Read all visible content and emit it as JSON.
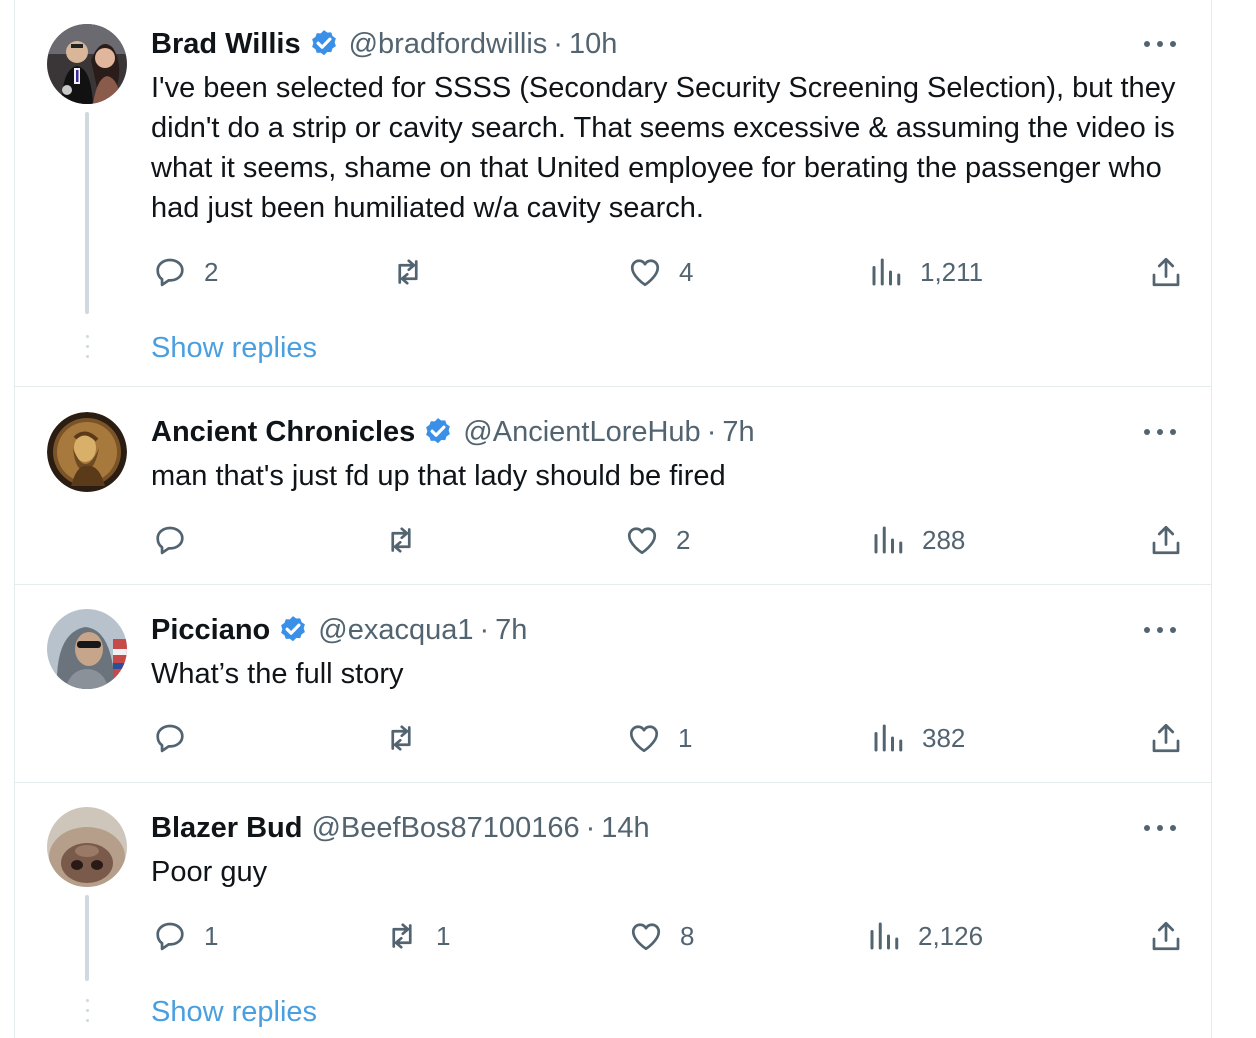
{
  "colors": {
    "link": "#4a9fe0",
    "verified": "#3a8fe8",
    "muted": "#536471",
    "border": "#e6ebee",
    "thread": "#cfd9de"
  },
  "tweets": [
    {
      "name": "Brad Willis",
      "verified": true,
      "handle": "@bradfordwillis",
      "sep": "·",
      "time": "10h",
      "text": "I've been selected for SSSS (Secondary Security Screening Selection), but they didn't do a strip or cavity search.  That seems excessive & assuming the video is what it seems, shame on that United employee for berating the passenger who had just been humiliated w/a cavity search.",
      "replies": "2",
      "retweets": "",
      "likes": "4",
      "views": "1,211",
      "show_replies": "Show replies",
      "icons": [
        "reply-icon",
        "retweet-icon",
        "like-icon",
        "views-icon",
        "share-icon",
        "more-icon"
      ]
    },
    {
      "name": "Ancient Chronicles",
      "verified": true,
      "handle": "@AncientLoreHub",
      "sep": "·",
      "time": "7h",
      "text": "man that's  just fd up that lady should be fired",
      "replies": "",
      "retweets": "",
      "likes": "2",
      "views": "288"
    },
    {
      "name": "Picciano",
      "verified": true,
      "handle": "@exacqua1",
      "sep": "·",
      "time": "7h",
      "text": "What’s the full story",
      "replies": "",
      "retweets": "",
      "likes": "1",
      "views": "382"
    },
    {
      "name": "Blazer Bud",
      "verified": false,
      "handle": "@BeefBos87100166",
      "sep": "·",
      "time": "14h",
      "text": "Poor guy",
      "replies": "1",
      "retweets": "1",
      "likes": "8",
      "views": "2,126",
      "show_replies": "Show replies"
    }
  ]
}
